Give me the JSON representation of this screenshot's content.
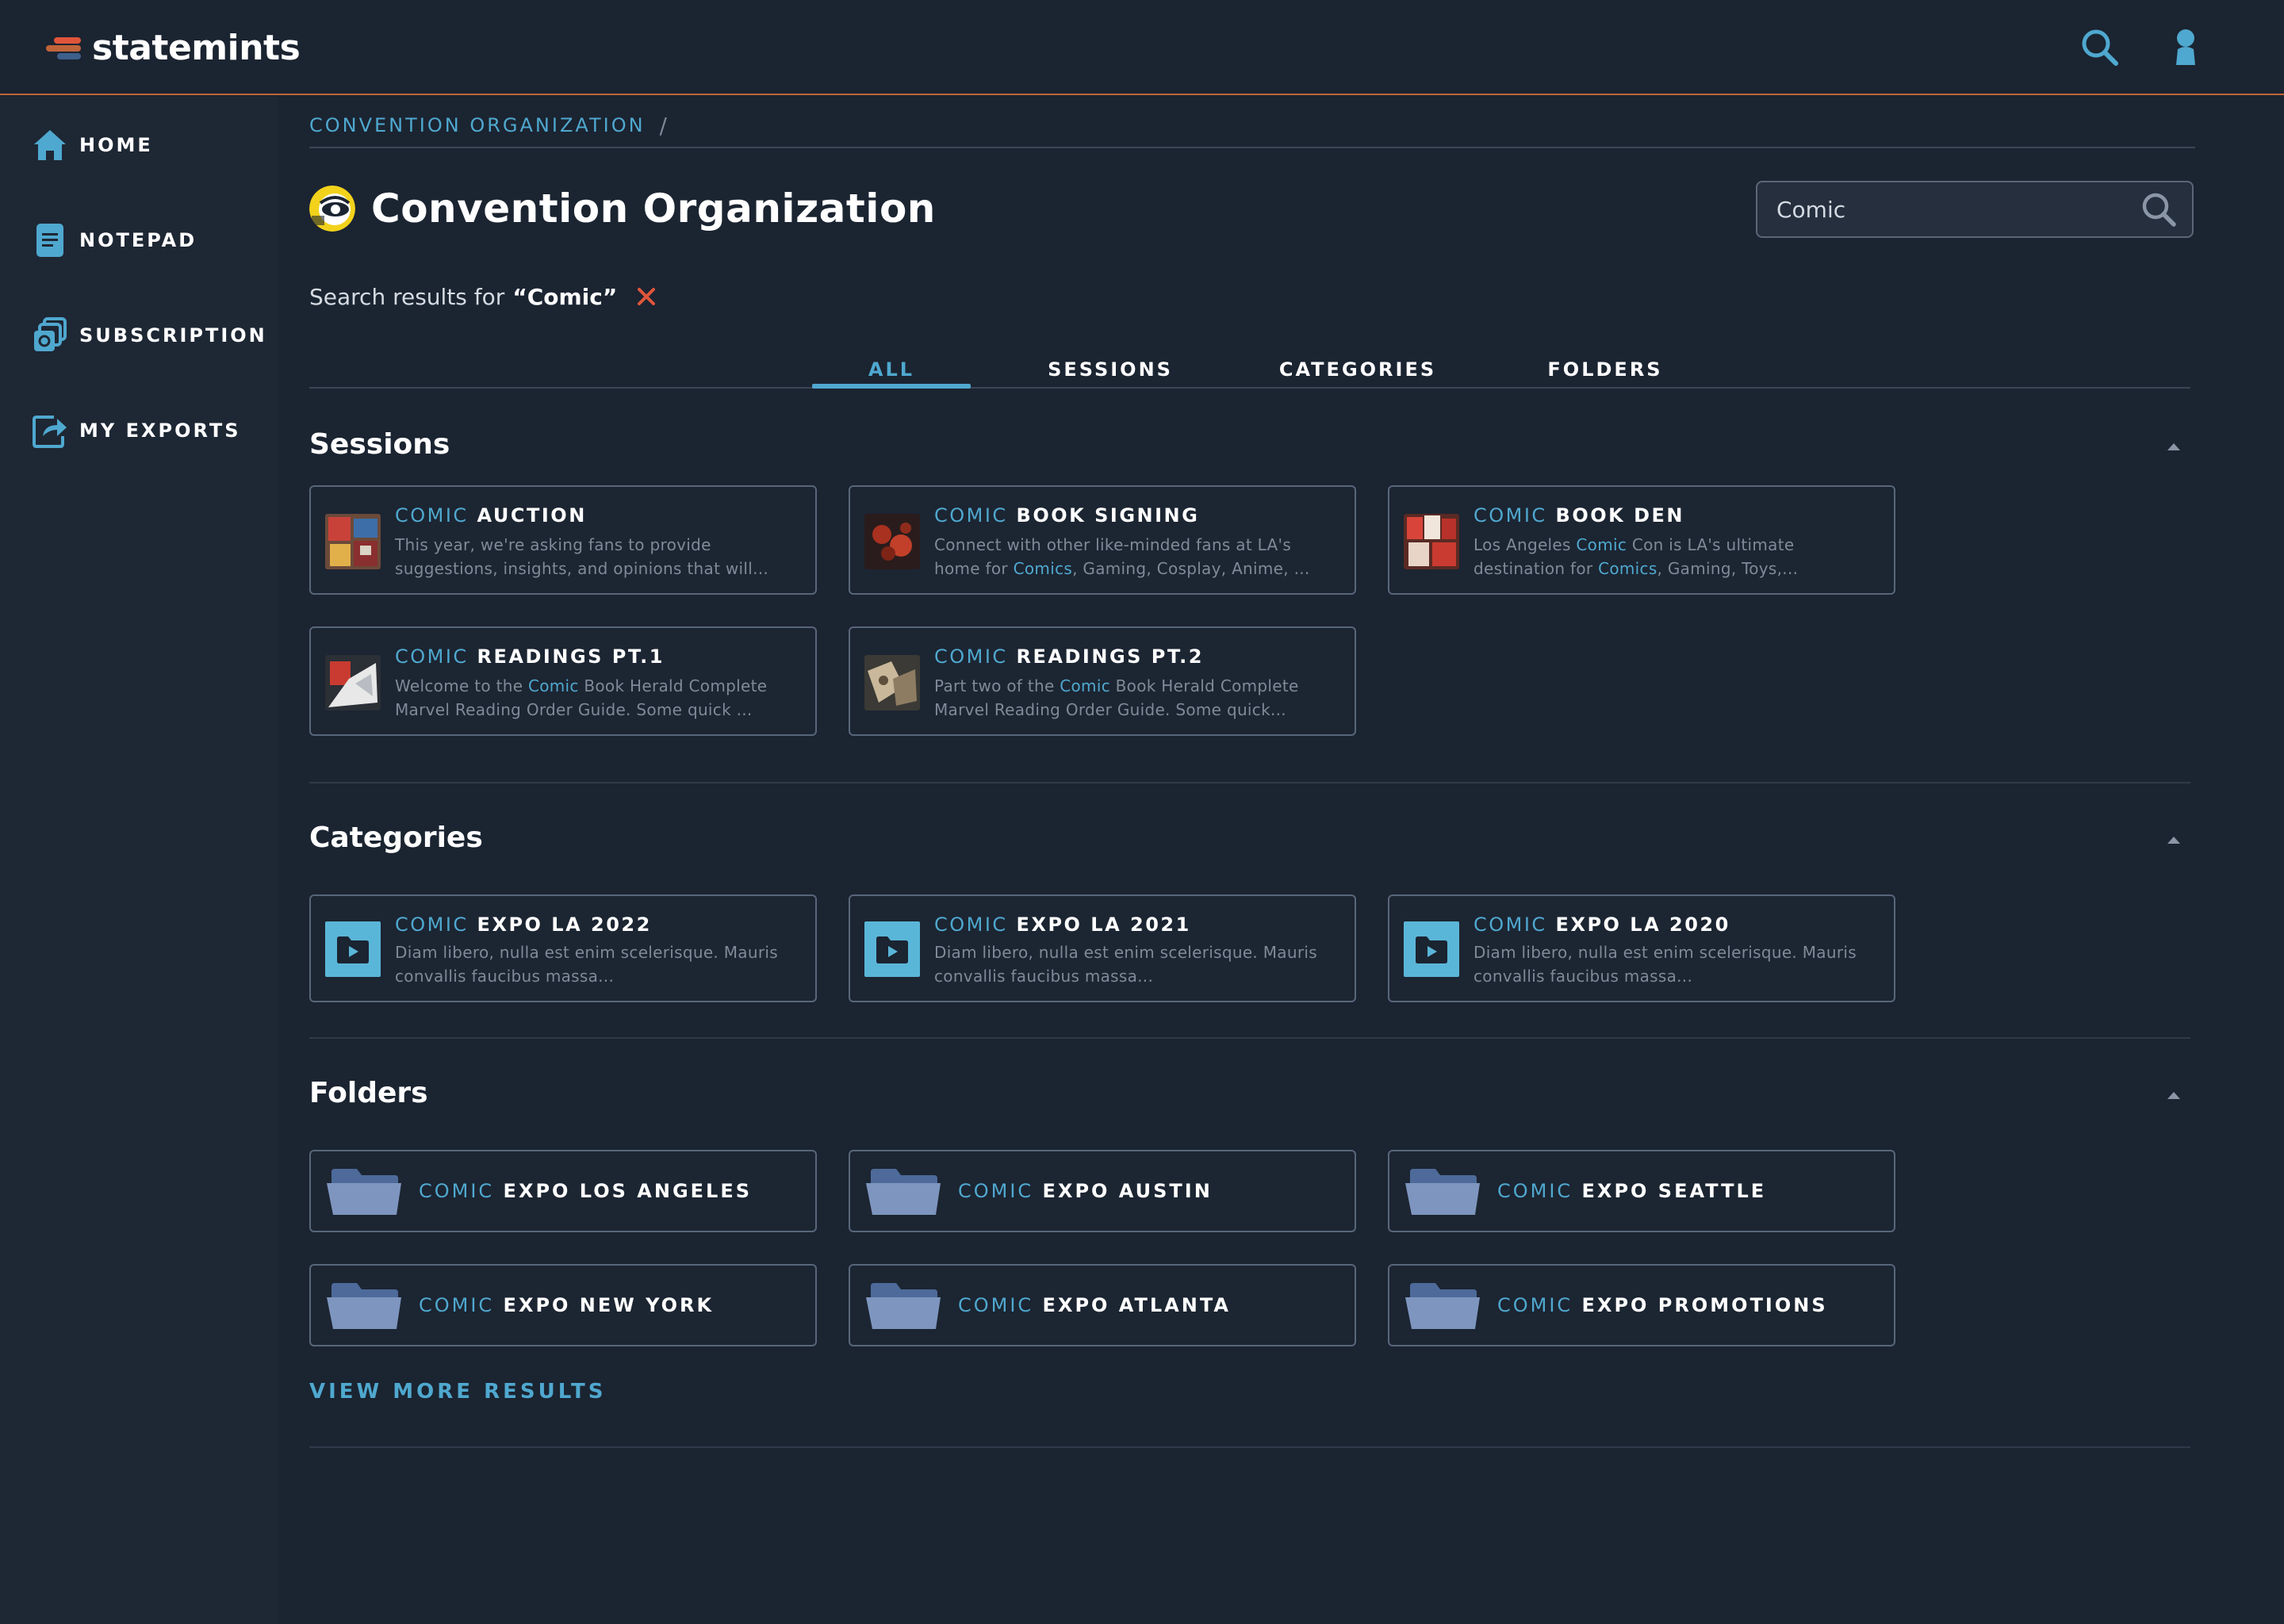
{
  "brand": {
    "name": "statemints"
  },
  "sidebar": {
    "items": [
      {
        "label": "HOME",
        "icon": "home-icon"
      },
      {
        "label": "NOTEPAD",
        "icon": "notepad-icon"
      },
      {
        "label": "SUBSCRIPTION",
        "icon": "subscription-icon"
      },
      {
        "label": "MY EXPORTS",
        "icon": "export-icon"
      }
    ]
  },
  "breadcrumb": {
    "items": [
      "CONVENTION ORGANIZATION"
    ],
    "separator": "/"
  },
  "page": {
    "title": "Convention Organization"
  },
  "search": {
    "value": "Comic"
  },
  "results": {
    "prefix": "Search results for",
    "query": "“Comic”"
  },
  "tabs": [
    "ALL",
    "SESSIONS",
    "CATEGORIES",
    "FOLDERS"
  ],
  "active_tab": "ALL",
  "sections": {
    "sessions": {
      "title": "Sessions",
      "items": [
        {
          "keyword": "COMIC",
          "rest": " AUCTION",
          "desc_html": "This year, we're asking fans to provide suggestions, insights, and opinions that will...",
          "desc": "This year, we're asking fans to provide suggestions, insights, and opinions that will..."
        },
        {
          "keyword": "COMIC",
          "rest": " BOOK SIGNING",
          "desc_a": "Connect with other like-minded fans at LA's home for ",
          "desc_kw": "Comics",
          "desc_b": ", Gaming, Cosplay, Anime, ..."
        },
        {
          "keyword": "COMIC",
          "rest": " BOOK DEN",
          "desc_a": "Los Angeles ",
          "desc_kw": "Comic",
          "desc_b": " Con is LA's ultimate destination for ",
          "desc_kw2": "Comics",
          "desc_c": ", Gaming, Toys,..."
        },
        {
          "keyword": "COMIC",
          "rest": " READINGS PT.1",
          "desc_a": "Welcome to the ",
          "desc_kw": "Comic",
          "desc_b": " Book Herald Complete Marvel Reading Order Guide. Some quick ..."
        },
        {
          "keyword": "COMIC",
          "rest": " READINGS PT.2",
          "desc_a": "Part two of the ",
          "desc_kw": "Comic",
          "desc_b": " Book Herald Complete Marvel Reading Order Guide. Some quick..."
        }
      ]
    },
    "categories": {
      "title": "Categories",
      "items": [
        {
          "keyword": "COMIC",
          "rest": " EXPO LA 2022",
          "desc": "Diam libero, nulla est enim scelerisque. Mauris convallis faucibus massa..."
        },
        {
          "keyword": "COMIC",
          "rest": " EXPO LA 2021",
          "desc": "Diam libero, nulla est enim scelerisque. Mauris convallis faucibus massa..."
        },
        {
          "keyword": "COMIC",
          "rest": " EXPO LA 2020",
          "desc": "Diam libero, nulla est enim scelerisque. Mauris convallis faucibus massa..."
        }
      ]
    },
    "folders": {
      "title": "Folders",
      "items": [
        {
          "keyword": "COMIC",
          "rest": " EXPO LOS ANGELES"
        },
        {
          "keyword": "COMIC",
          "rest": " EXPO AUSTIN"
        },
        {
          "keyword": "COMIC",
          "rest": " EXPO SEATTLE"
        },
        {
          "keyword": "COMIC",
          "rest": " EXPO NEW YORK"
        },
        {
          "keyword": "COMIC",
          "rest": " EXPO ATLANTA"
        },
        {
          "keyword": "COMIC",
          "rest": " EXPO PROMOTIONS"
        }
      ]
    }
  },
  "view_more": "VIEW MORE RESULTS",
  "colors": {
    "background": "#1b2431",
    "sidebar": "#1e2734",
    "accent": "#4fa8cf",
    "brand_line": "#c0643a",
    "clear_x": "#e0553a",
    "card_border": "#57667a"
  }
}
